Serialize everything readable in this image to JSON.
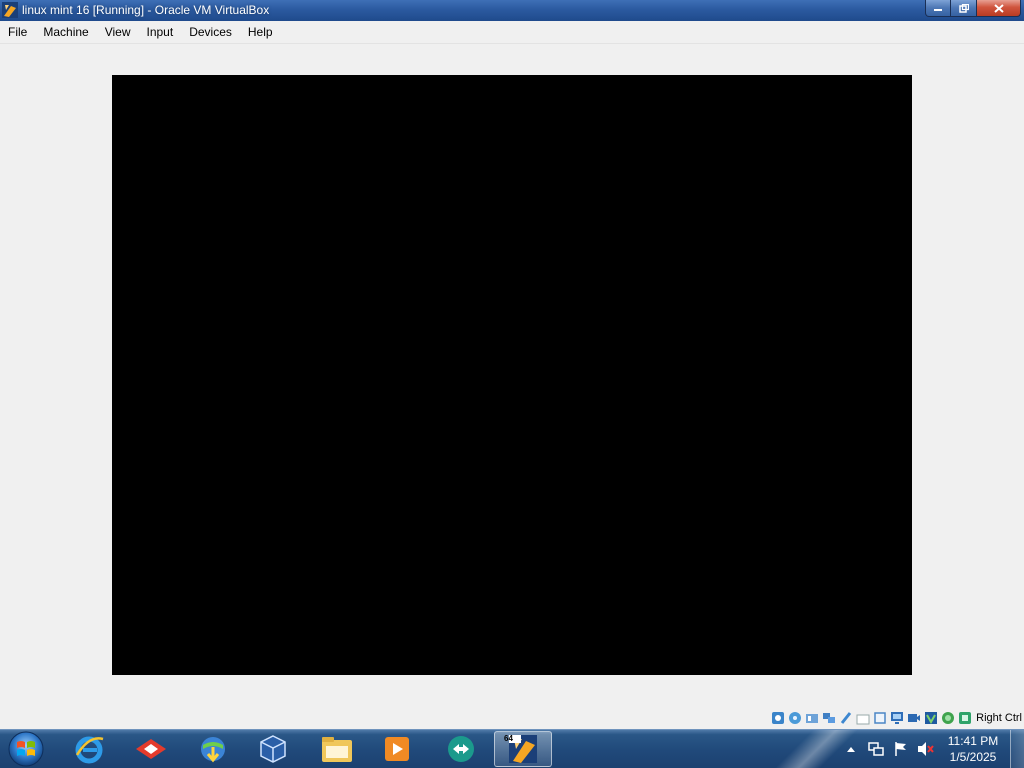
{
  "window": {
    "title": "linux mint 16 [Running] - Oracle VM VirtualBox",
    "icon": "virtualbox-vm-icon",
    "controls": [
      "minimize-icon",
      "restore-icon",
      "close-icon"
    ]
  },
  "menu": {
    "items": [
      {
        "label": "File"
      },
      {
        "label": "Machine"
      },
      {
        "label": "View"
      },
      {
        "label": "Input"
      },
      {
        "label": "Devices"
      },
      {
        "label": "Help"
      }
    ]
  },
  "status_bar": {
    "icons": [
      "hard-disk-icon",
      "optical-drive-icon",
      "audio-icon",
      "network-icon",
      "usb-icon",
      "shared-folders-icon",
      "clipboard-icon",
      "display-icon",
      "video-capture-icon",
      "virtualization-icon",
      "mouse-integration-icon",
      "keyboard-capture-icon"
    ],
    "host_key": "Right Ctrl"
  },
  "taskbar": {
    "pinned": [
      "internet-explorer-icon",
      "gamemaker-icon",
      "internet-download-manager-icon",
      "virtualbox-icon",
      "windows-explorer-icon",
      "media-player-icon",
      "teamviewer-icon"
    ],
    "active_app": "virtualbox-vm-icon",
    "active_app_badge": "64"
  },
  "tray": {
    "icons": [
      "show-hidden-icons-arrow",
      "network-icon",
      "action-center-flag-icon",
      "volume-muted-icon"
    ],
    "time": "11:41 PM",
    "date": "1/5/2025"
  },
  "colors": {
    "titlebar": "#2b5aa0",
    "vm_screen": "#000000",
    "window_bg": "#f0f0f0",
    "taskbar": "#20497a"
  }
}
